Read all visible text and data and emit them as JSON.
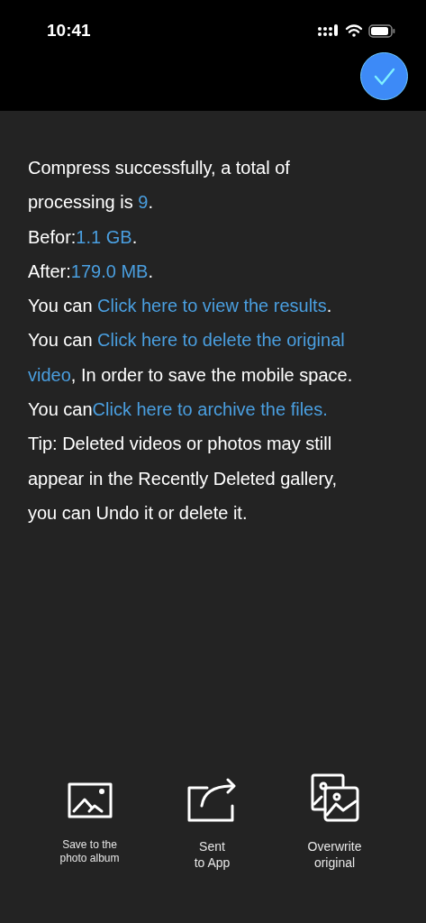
{
  "status_bar": {
    "time": "10:41"
  },
  "lines": [
    {
      "segments": [
        {
          "kind": "text",
          "text": "Compress successfully, a total of"
        }
      ]
    },
    {
      "segments": [
        {
          "kind": "text",
          "text": "processing is "
        },
        {
          "kind": "value",
          "text": "9"
        },
        {
          "kind": "text",
          "text": "."
        }
      ]
    },
    {
      "segments": [
        {
          "kind": "text",
          "text": "Befor:"
        },
        {
          "kind": "value",
          "text": "1.1 GB"
        },
        {
          "kind": "text",
          "text": "."
        }
      ]
    },
    {
      "segments": [
        {
          "kind": "text",
          "text": "After:"
        },
        {
          "kind": "value",
          "text": "179.0 MB"
        },
        {
          "kind": "text",
          "text": "."
        }
      ]
    },
    {
      "segments": [
        {
          "kind": "text",
          "text": "You can "
        },
        {
          "kind": "link",
          "text": "Click here to view the results"
        },
        {
          "kind": "text",
          "text": "."
        }
      ]
    },
    {
      "segments": [
        {
          "kind": "text",
          "text": "You can "
        },
        {
          "kind": "link",
          "text": "Click here to delete the original"
        }
      ]
    },
    {
      "segments": [
        {
          "kind": "link",
          "text": "video"
        },
        {
          "kind": "text",
          "text": ", In order to save the mobile space."
        }
      ]
    },
    {
      "segments": [
        {
          "kind": "text",
          "text": "You can"
        },
        {
          "kind": "link",
          "text": "Click here to archive the files."
        }
      ]
    },
    {
      "segments": [
        {
          "kind": "text",
          "text": "Tip: Deleted videos or photos may still"
        }
      ]
    },
    {
      "segments": [
        {
          "kind": "text",
          "text": "appear in the Recently Deleted gallery,"
        }
      ]
    },
    {
      "segments": [
        {
          "kind": "text",
          "text": "you can Undo it or delete it."
        }
      ]
    }
  ],
  "actions": [
    {
      "kind": "album",
      "label": "Save to the photo album"
    },
    {
      "kind": "share",
      "label": "Sent to App"
    },
    {
      "kind": "overwrite",
      "label": "Overwrite original"
    }
  ]
}
